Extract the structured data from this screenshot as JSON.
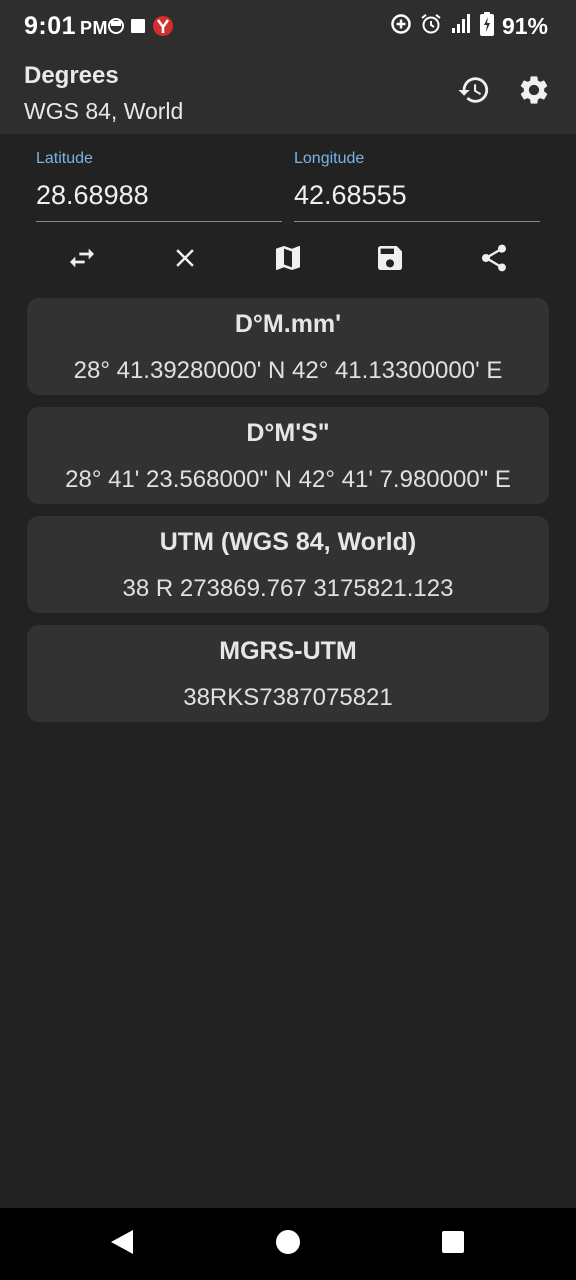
{
  "status_bar": {
    "time": "9:01",
    "ampm": "PM",
    "battery_percent": "91%",
    "left_icons": [
      "notification-icon",
      "square-notification-icon",
      "app-notification-icon"
    ],
    "right_icons": [
      "data-saver-icon",
      "alarm-icon",
      "signal-icon",
      "battery-charging-icon"
    ]
  },
  "app_bar": {
    "title": "Degrees",
    "subtitle": "WGS 84, World",
    "actions": [
      "history-icon",
      "settings-icon"
    ]
  },
  "inputs": {
    "latitude": {
      "label": "Latitude",
      "value": "28.68988"
    },
    "longitude": {
      "label": "Longitude",
      "value": "42.68555"
    }
  },
  "toolbar": {
    "buttons": [
      "swap-icon",
      "clear-icon",
      "map-icon",
      "save-icon",
      "share-icon"
    ]
  },
  "results": [
    {
      "title": "D°M.mm'",
      "value": "28° 41.39280000' N 42° 41.13300000' E"
    },
    {
      "title": "D°M'S\"",
      "value": "28° 41' 23.568000\" N 42° 41' 7.980000\" E"
    },
    {
      "title": "UTM (WGS 84, World)",
      "value": "38 R 273869.767 3175821.123"
    },
    {
      "title": "MGRS-UTM",
      "value": "38RKS7387075821"
    }
  ],
  "colors": {
    "background": "#222222",
    "app_bar": "#2e2e2e",
    "card": "#323232",
    "label_accent": "#7ab4e6",
    "notification_red": "#d32f2f"
  }
}
